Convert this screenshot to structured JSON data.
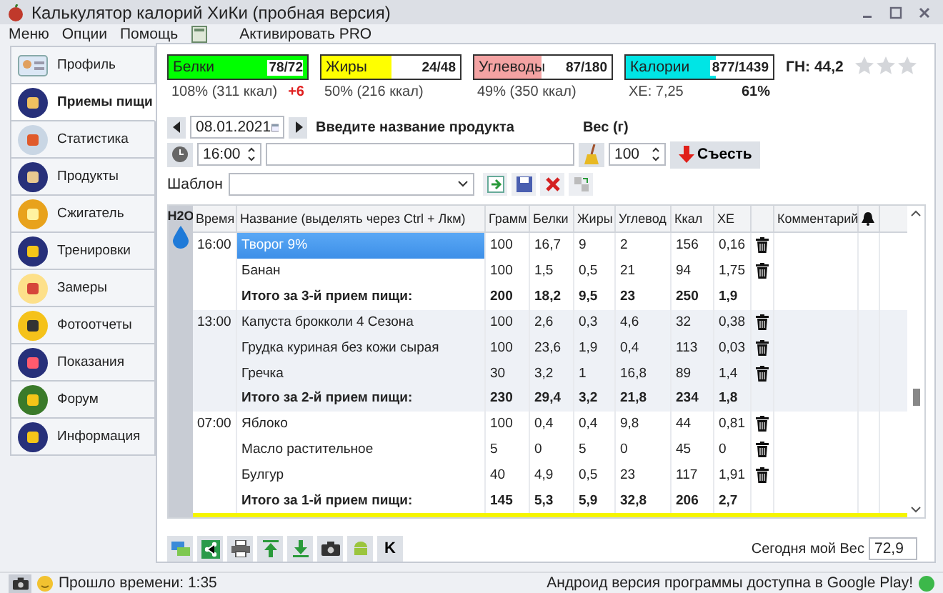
{
  "window": {
    "title": "Калькулятор калорий ХиКи (пробная версия)"
  },
  "menu": [
    "Меню",
    "Опции",
    "Помощь"
  ],
  "menu_link": "Активировать PRO",
  "sidebar": {
    "items": [
      {
        "label": "Профиль",
        "selected": false
      },
      {
        "label": "Приемы пищи",
        "selected": true
      },
      {
        "label": "Статистика",
        "selected": false
      },
      {
        "label": "Продукты",
        "selected": false
      },
      {
        "label": "Сжигатель",
        "selected": false
      },
      {
        "label": "Тренировки",
        "selected": false
      },
      {
        "label": "Замеры",
        "selected": false
      },
      {
        "label": "Фотоотчеты",
        "selected": false
      },
      {
        "label": "Показания",
        "selected": false
      },
      {
        "label": "Форум",
        "selected": false
      },
      {
        "label": "Информация",
        "selected": false
      }
    ]
  },
  "nutrients": [
    {
      "name": "Белки",
      "value": "78/72",
      "level": 1,
      "color": "#00ff00",
      "note": "108% (311 ккал)",
      "delta": "+6"
    },
    {
      "name": "Жиры",
      "value": "24/48",
      "level": 0.5,
      "color": "#ffff00",
      "note": "50% (216 ккал)"
    },
    {
      "name": "Углеводы",
      "value": "87/180",
      "level": 0.49,
      "color": "#f4a3a3",
      "note": "49% (350 ккал)"
    },
    {
      "name": "Калории",
      "value": "877/1439",
      "level": 0.61,
      "color": "#00e5e5",
      "note": "ХЕ: 7,25",
      "percent": "61%"
    }
  ],
  "gi": "ГН: 44,2",
  "stars": 0,
  "date": "08.01.2021",
  "product_label": "Введите название продукта",
  "weight_label": "Вес (г)",
  "time": "16:00",
  "weight": "100",
  "eat_button": "Съесть",
  "template_label": "Шаблон",
  "table": {
    "water_label": "H2O",
    "columns": [
      "Время",
      "Название (выделять через Ctrl + Лкм)",
      "Грамм",
      "Белки",
      "Жиры",
      "Углевод",
      "Ккал",
      "ХЕ",
      "",
      "Комментарий"
    ],
    "meals": [
      {
        "time": "16:00",
        "items": [
          {
            "name": "Творог 9%",
            "values": [
              "100",
              "16,7",
              "9",
              "2",
              "156",
              "0,16"
            ],
            "selected": true
          },
          {
            "name": "Банан",
            "values": [
              "100",
              "1,5",
              "0,5",
              "21",
              "94",
              "1,75"
            ],
            "selected": false
          }
        ],
        "total": {
          "label": "Итого за 3-й прием пищи:",
          "values": [
            "200",
            "18,2",
            "9,5",
            "23",
            "250",
            "1,9"
          ]
        }
      },
      {
        "time": "13:00",
        "items": [
          {
            "name": "Капуста брокколи 4 Сезона",
            "values": [
              "100",
              "2,6",
              "0,3",
              "4,6",
              "32",
              "0,38"
            ],
            "selected": false
          },
          {
            "name": "Грудка куриная без кожи сырая",
            "values": [
              "100",
              "23,6",
              "1,9",
              "0,4",
              "113",
              "0,03"
            ],
            "selected": false
          },
          {
            "name": "Гречка",
            "values": [
              "30",
              "3,2",
              "1",
              "16,8",
              "89",
              "1,4"
            ],
            "selected": false
          }
        ],
        "total": {
          "label": "Итого за 2-й прием пищи:",
          "values": [
            "230",
            "29,4",
            "3,2",
            "21,8",
            "234",
            "1,8"
          ]
        }
      },
      {
        "time": "07:00",
        "items": [
          {
            "name": "Яблоко",
            "values": [
              "100",
              "0,4",
              "0,4",
              "9,8",
              "44",
              "0,81"
            ],
            "selected": false
          },
          {
            "name": "Масло растительное",
            "values": [
              "5",
              "0",
              "5",
              "0",
              "45",
              "0"
            ],
            "selected": false
          },
          {
            "name": "Булгур",
            "values": [
              "40",
              "4,9",
              "0,5",
              "23",
              "117",
              "1,91"
            ],
            "selected": false
          }
        ],
        "total": {
          "label": "Итого за 1-й прием пищи:",
          "values": [
            "145",
            "5,3",
            "5,9",
            "32,8",
            "206",
            "2,7"
          ]
        }
      }
    ]
  },
  "k_button": "K",
  "today_weight_label": "Сегодня мой Вес",
  "today_weight": "72,9",
  "status_bar": {
    "elapsed": "Прошло времени: 1:35",
    "message": "Андроид версия программы доступна в Google Play!"
  }
}
